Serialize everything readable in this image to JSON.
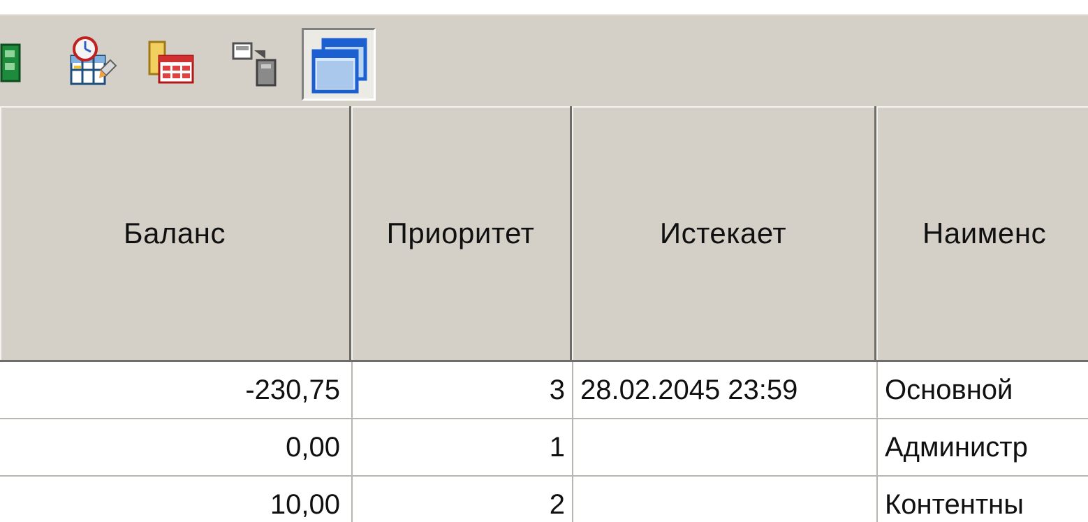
{
  "toolbar": {
    "buttons": [
      {
        "icon": "partial-green-icon"
      },
      {
        "icon": "table-clock-icon"
      },
      {
        "icon": "table-columns-icon"
      },
      {
        "icon": "copy-paste-icon"
      },
      {
        "icon": "window-cascade-icon",
        "pressed": true
      }
    ]
  },
  "table": {
    "columns": [
      "Баланс",
      "Приоритет",
      "Истекает",
      "Наименс"
    ],
    "rows": [
      {
        "balance": "-230,75",
        "priority": "3",
        "expires": "28.02.2045 23:59",
        "name": "Основной"
      },
      {
        "balance": "0,00",
        "priority": "1",
        "expires": "",
        "name": "Администр"
      },
      {
        "balance": "10,00",
        "priority": "2",
        "expires": "",
        "name": "Контентны"
      }
    ]
  },
  "colors": {
    "face": "#d4d0c8",
    "grid_line": "#b8b6b0",
    "header_shadow": "#6f6d69",
    "window_blue": "#1b5fd0"
  }
}
